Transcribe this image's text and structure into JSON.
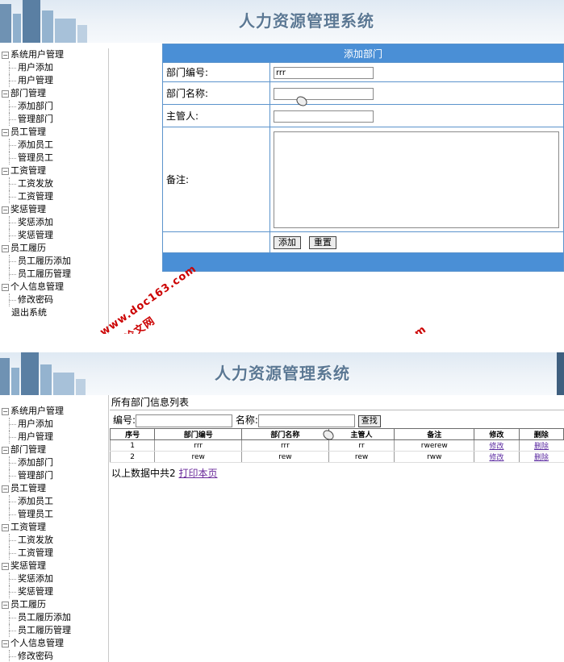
{
  "app": {
    "title": "人力资源管理系统"
  },
  "sidebar": {
    "groups": [
      {
        "label": "系统用户管理",
        "items": [
          "用户添加",
          "用户管理"
        ]
      },
      {
        "label": "部门管理",
        "items": [
          "添加部门",
          "管理部门"
        ]
      },
      {
        "label": "员工管理",
        "items": [
          "添加员工",
          "管理员工"
        ]
      },
      {
        "label": "工资管理",
        "items": [
          "工资发放",
          "工资管理"
        ]
      },
      {
        "label": "奖惩管理",
        "items": [
          "奖惩添加",
          "奖惩管理"
        ]
      },
      {
        "label": "员工履历",
        "items": [
          "员工履历添加",
          "员工履历管理"
        ]
      },
      {
        "label": "个人信息管理",
        "items": [
          "修改密码"
        ]
      }
    ],
    "logout": "退出系统",
    "expander": "−"
  },
  "add_form": {
    "header": "添加部门",
    "dept_no_label": "部门编号:",
    "dept_no_value": "rrr",
    "dept_name_label": "部门名称:",
    "dept_name_value": "",
    "manager_label": "主管人:",
    "manager_value": "",
    "remark_label": "备注:",
    "add_button": "添加",
    "reset_button": "重置"
  },
  "dept_list": {
    "title": "所有部门信息列表",
    "search_no_label": "编号:",
    "search_name_label": "名称:",
    "search_button": "查找",
    "columns": [
      "序号",
      "部门编号",
      "部门名称",
      "主管人",
      "备注",
      "修改",
      "删除"
    ],
    "rows": [
      {
        "seq": "1",
        "no": "rrr",
        "name": "rrr",
        "manager": "rr",
        "remark": "rwerew",
        "edit": "修改",
        "del": "删除"
      },
      {
        "seq": "2",
        "no": "rew",
        "name": "rew",
        "manager": "rew",
        "remark": "rww",
        "edit": "修改",
        "del": "删除"
      }
    ],
    "summary_prefix": "以上数据中共",
    "summary_count": "2",
    "print_link": "打印本页"
  },
  "watermark": {
    "cn": "毕业设计论文网",
    "url": "www.doc163.com"
  },
  "colors": {
    "header_blue": "#4a8fd6",
    "border_blue": "#5b93cc",
    "title_text": "#5b7894"
  }
}
